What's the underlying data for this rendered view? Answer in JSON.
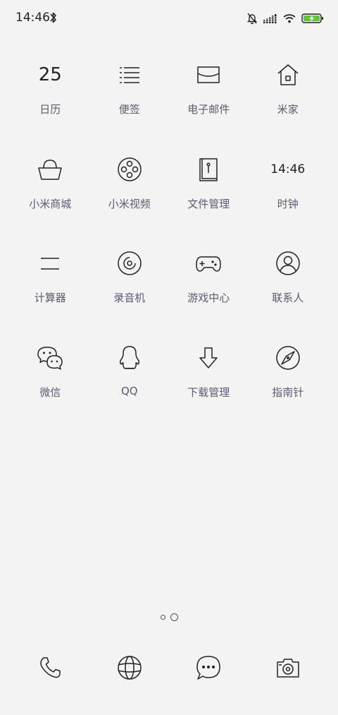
{
  "status_bar": {
    "time": "14:46",
    "icons": [
      "bluetooth-icon",
      "mute-bell-icon",
      "signal-icon",
      "wifi-icon",
      "battery-charging-icon"
    ],
    "battery_color": "#5ac832"
  },
  "apps": [
    {
      "label": "日历",
      "icon": "calendar-icon",
      "icon_text": "25"
    },
    {
      "label": "便签",
      "icon": "notes-icon"
    },
    {
      "label": "电子邮件",
      "icon": "email-icon"
    },
    {
      "label": "米家",
      "icon": "home-icon"
    },
    {
      "label": "小米商城",
      "icon": "shopping-bag-icon"
    },
    {
      "label": "小米视频",
      "icon": "film-reel-icon"
    },
    {
      "label": "文件管理",
      "icon": "file-manager-icon"
    },
    {
      "label": "时钟",
      "icon": "clock-icon",
      "icon_text": "14:46"
    },
    {
      "label": "计算器",
      "icon": "calculator-icon"
    },
    {
      "label": "录音机",
      "icon": "recorder-icon"
    },
    {
      "label": "游戏中心",
      "icon": "gamepad-icon"
    },
    {
      "label": "联系人",
      "icon": "contacts-icon"
    },
    {
      "label": "微信",
      "icon": "wechat-icon"
    },
    {
      "label": "QQ",
      "icon": "qq-penguin-icon"
    },
    {
      "label": "下载管理",
      "icon": "download-icon"
    },
    {
      "label": "指南针",
      "icon": "compass-icon"
    }
  ],
  "page_indicator": {
    "pages": 2,
    "current": 2
  },
  "dock": [
    {
      "icon": "phone-icon"
    },
    {
      "icon": "browser-globe-icon"
    },
    {
      "icon": "messages-icon"
    },
    {
      "icon": "camera-icon"
    }
  ]
}
